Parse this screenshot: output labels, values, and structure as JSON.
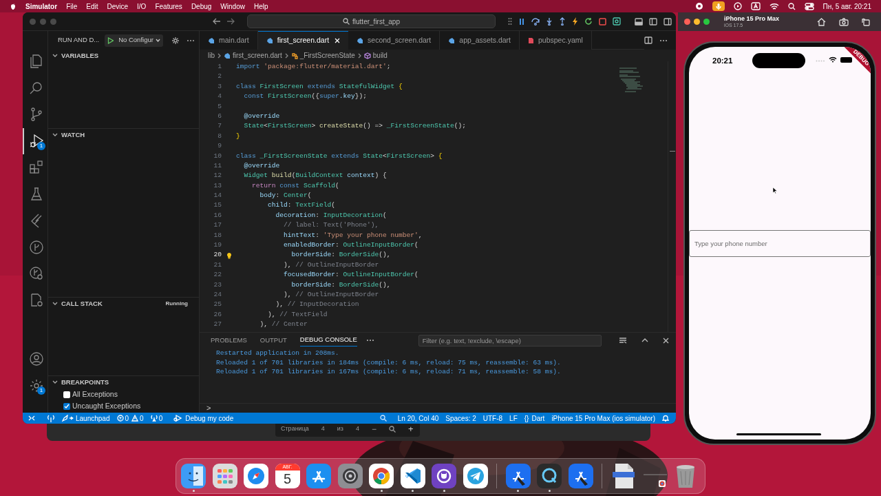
{
  "menu_bar": {
    "app": "Simulator",
    "items": [
      "File",
      "Edit",
      "Device",
      "I/O",
      "Features",
      "Debug",
      "Window",
      "Help"
    ],
    "clock": "Пн, 5 авг. 20:21"
  },
  "vscode": {
    "search": "flutter_first_app",
    "activity": [
      {
        "kind": "files",
        "selected": false
      },
      {
        "kind": "search",
        "selected": false
      },
      {
        "kind": "branch",
        "selected": false
      },
      {
        "kind": "debug",
        "selected": true,
        "badge": "1"
      },
      {
        "kind": "blocks",
        "selected": false
      },
      {
        "kind": "flask",
        "selected": false
      },
      {
        "kind": "chevrons",
        "selected": false
      },
      {
        "kind": "circle-branch",
        "selected": false
      },
      {
        "kind": "circle-branch-gear",
        "selected": false
      },
      {
        "kind": "doc-gear",
        "selected": false
      }
    ],
    "activity_bottom": [
      {
        "kind": "account"
      },
      {
        "kind": "gear",
        "badge": "1"
      }
    ],
    "sidebar": {
      "title": "RUN AND D...",
      "config": "No Configur",
      "sections": [
        {
          "title": "VARIABLES"
        },
        {
          "title": "WATCH"
        },
        {
          "title": "CALL STACK",
          "status": "Running"
        }
      ],
      "breakpoints_title": "BREAKPOINTS",
      "breakpoints": [
        {
          "label": "All Exceptions",
          "checked": false
        },
        {
          "label": "Uncaught Exceptions",
          "checked": true
        }
      ]
    },
    "tabs": [
      {
        "label": "main.dart",
        "kind": "dart",
        "selected": false
      },
      {
        "label": "first_screen.dart",
        "kind": "dart",
        "selected": true
      },
      {
        "label": "second_screen.dart",
        "kind": "dart",
        "selected": false
      },
      {
        "label": "app_assets.dart",
        "kind": "dart",
        "selected": false
      },
      {
        "label": "pubspec.yaml",
        "kind": "yaml",
        "selected": false
      }
    ],
    "breadcrumb": [
      {
        "label": "lib",
        "kind": "folder"
      },
      {
        "label": "first_screen.dart",
        "kind": "dart"
      },
      {
        "label": "_FirstScreenState",
        "kind": "class"
      },
      {
        "label": "build",
        "kind": "method"
      }
    ],
    "code": [
      {
        "n": "1",
        "current": false,
        "tokens": [
          {
            "text": "import ",
            "kind": "kw"
          },
          {
            "text": "'package:flutter/material.dart'",
            "kind": "str"
          },
          {
            "text": ";",
            "kind": "p"
          }
        ]
      },
      {
        "n": "2",
        "current": false
      },
      {
        "n": "3",
        "current": false,
        "tokens": [
          {
            "text": "class ",
            "kind": "kw"
          },
          {
            "text": "FirstScreen ",
            "kind": "cls"
          },
          {
            "text": "extends ",
            "kind": "kw"
          },
          {
            "text": "StatefulWidget ",
            "kind": "cls"
          },
          {
            "text": "{",
            "kind": "br"
          }
        ]
      },
      {
        "n": "4",
        "current": false,
        "tokens": [
          {
            "text": "  const ",
            "kind": "kw"
          },
          {
            "text": "FirstScreen",
            "kind": "cls"
          },
          {
            "text": "({",
            "kind": "p"
          },
          {
            "text": "super",
            "kind": "kw"
          },
          {
            "text": ".key",
            "kind": "var"
          },
          {
            "text": "});",
            "kind": "p"
          }
        ]
      },
      {
        "n": "5",
        "current": false
      },
      {
        "n": "6",
        "current": false,
        "tokens": [
          {
            "text": "  @override",
            "kind": "var"
          }
        ]
      },
      {
        "n": "7",
        "current": false,
        "tokens": [
          {
            "text": "  State",
            "kind": "cls"
          },
          {
            "text": "<",
            "kind": "p"
          },
          {
            "text": "FirstScreen",
            "kind": "cls"
          },
          {
            "text": "> ",
            "kind": "p"
          },
          {
            "text": "createState",
            "kind": "fn"
          },
          {
            "text": "() => ",
            "kind": "p"
          },
          {
            "text": "_FirstScreenState",
            "kind": "cls"
          },
          {
            "text": "();",
            "kind": "p"
          }
        ]
      },
      {
        "n": "8",
        "current": false,
        "tokens": [
          {
            "text": "}",
            "kind": "br"
          }
        ]
      },
      {
        "n": "9",
        "current": false
      },
      {
        "n": "10",
        "current": false,
        "tokens": [
          {
            "text": "class ",
            "kind": "kw"
          },
          {
            "text": "_FirstScreenState ",
            "kind": "cls"
          },
          {
            "text": "extends ",
            "kind": "kw"
          },
          {
            "text": "State",
            "kind": "cls"
          },
          {
            "text": "<",
            "kind": "p"
          },
          {
            "text": "FirstScreen",
            "kind": "cls"
          },
          {
            "text": "> ",
            "kind": "p"
          },
          {
            "text": "{",
            "kind": "br"
          }
        ]
      },
      {
        "n": "11",
        "current": false,
        "tokens": [
          {
            "text": "  @override",
            "kind": "var"
          }
        ]
      },
      {
        "n": "12",
        "current": false,
        "tokens": [
          {
            "text": "  Widget ",
            "kind": "cls"
          },
          {
            "text": "build",
            "kind": "fn"
          },
          {
            "text": "(",
            "kind": "p"
          },
          {
            "text": "BuildContext ",
            "kind": "cls"
          },
          {
            "text": "context",
            "kind": "var"
          },
          {
            "text": ") {",
            "kind": "p"
          }
        ]
      },
      {
        "n": "13",
        "current": false,
        "tokens": [
          {
            "text": "    return ",
            "kind": "ctrl"
          },
          {
            "text": "const ",
            "kind": "kw"
          },
          {
            "text": "Scaffold",
            "kind": "cls"
          },
          {
            "text": "(",
            "kind": "p"
          }
        ]
      },
      {
        "n": "14",
        "current": false,
        "tokens": [
          {
            "text": "      body",
            "kind": "var"
          },
          {
            "text": ": ",
            "kind": "p"
          },
          {
            "text": "Center",
            "kind": "cls"
          },
          {
            "text": "(",
            "kind": "p"
          }
        ]
      },
      {
        "n": "15",
        "current": false,
        "tokens": [
          {
            "text": "        child",
            "kind": "var"
          },
          {
            "text": ": ",
            "kind": "p"
          },
          {
            "text": "TextField",
            "kind": "cls"
          },
          {
            "text": "(",
            "kind": "p"
          }
        ]
      },
      {
        "n": "16",
        "current": false,
        "tokens": [
          {
            "text": "          decoration",
            "kind": "var"
          },
          {
            "text": ": ",
            "kind": "p"
          },
          {
            "text": "InputDecoration",
            "kind": "cls"
          },
          {
            "text": "(",
            "kind": "p"
          }
        ]
      },
      {
        "n": "17",
        "current": false,
        "tokens": [
          {
            "text": "            // label: Text('Phone'),",
            "kind": "com"
          }
        ]
      },
      {
        "n": "18",
        "current": false,
        "tokens": [
          {
            "text": "            hintText",
            "kind": "var"
          },
          {
            "text": ": ",
            "kind": "p"
          },
          {
            "text": "'Type your phone number'",
            "kind": "str"
          },
          {
            "text": ",",
            "kind": "p"
          }
        ]
      },
      {
        "n": "19",
        "current": false,
        "tokens": [
          {
            "text": "            enabledBorder",
            "kind": "var"
          },
          {
            "text": ": ",
            "kind": "p"
          },
          {
            "text": "OutlineInputBorder",
            "kind": "cls"
          },
          {
            "text": "(",
            "kind": "p"
          }
        ]
      },
      {
        "n": "20",
        "current": true,
        "tokens": [
          {
            "text": "              borderSide",
            "kind": "var"
          },
          {
            "text": ": ",
            "kind": "p"
          },
          {
            "text": "BorderSide",
            "kind": "cls"
          },
          {
            "text": "(),",
            "kind": "p"
          }
        ]
      },
      {
        "n": "21",
        "current": false,
        "tokens": [
          {
            "text": "            ), ",
            "kind": "p"
          },
          {
            "text": "// OutlineInputBorder",
            "kind": "com"
          }
        ]
      },
      {
        "n": "22",
        "current": false,
        "tokens": [
          {
            "text": "            focusedBorder",
            "kind": "var"
          },
          {
            "text": ": ",
            "kind": "p"
          },
          {
            "text": "OutlineInputBorder",
            "kind": "cls"
          },
          {
            "text": "(",
            "kind": "p"
          }
        ]
      },
      {
        "n": "23",
        "current": false,
        "tokens": [
          {
            "text": "              borderSide",
            "kind": "var"
          },
          {
            "text": ": ",
            "kind": "p"
          },
          {
            "text": "BorderSide",
            "kind": "cls"
          },
          {
            "text": "(),",
            "kind": "p"
          }
        ]
      },
      {
        "n": "24",
        "current": false,
        "tokens": [
          {
            "text": "            ), ",
            "kind": "p"
          },
          {
            "text": "// OutlineInputBorder",
            "kind": "com"
          }
        ]
      },
      {
        "n": "25",
        "current": false,
        "tokens": [
          {
            "text": "          ), ",
            "kind": "p"
          },
          {
            "text": "// InputDecoration",
            "kind": "com"
          }
        ]
      },
      {
        "n": "26",
        "current": false,
        "tokens": [
          {
            "text": "        ), ",
            "kind": "p"
          },
          {
            "text": "// TextField",
            "kind": "com"
          }
        ]
      },
      {
        "n": "27",
        "current": false,
        "tokens": [
          {
            "text": "      ), ",
            "kind": "p"
          },
          {
            "text": "// Center",
            "kind": "com"
          }
        ]
      }
    ],
    "panel": {
      "tabs": [
        {
          "label": "PROBLEMS",
          "selected": false
        },
        {
          "label": "OUTPUT",
          "selected": false
        },
        {
          "label": "DEBUG CONSOLE",
          "selected": true
        }
      ],
      "filter_placeholder": "Filter (e.g. text, !exclude, \\escape)",
      "lines": [
        "Restarted application in 208ms.",
        "Reloaded 1 of 701 libraries in 184ms (compile: 6 ms, reload: 75 ms, reassemble: 63 ms).",
        "Reloaded 1 of 701 libraries in 167ms (compile: 6 ms, reload: 71 ms, reassemble: 58 ms)."
      ],
      "prompt": ">"
    },
    "status_bar": {
      "launchpad": "Launchpad",
      "errors": "0",
      "warnings": "0",
      "ports": "0",
      "debug": "Debug my code",
      "items": [
        "Ln 20, Col 40",
        "Spaces: 2",
        "UTF-8",
        "LF"
      ],
      "language_icon": "{}",
      "language": "Dart",
      "device": "iPhone 15 Pro Max (ios simulator)"
    }
  },
  "pdf_toolbar": {
    "label": "Страница",
    "page": "4",
    "of": "из",
    "total": "4",
    "minus": "−",
    "plus": "+"
  },
  "simulator": {
    "title": "iPhone 15 Pro Max",
    "os": "iOS 17.5",
    "time": "20:21",
    "banner": "DEBUG",
    "placeholder": "Type your phone number"
  },
  "dock": [
    {
      "kind": "finder",
      "running": true
    },
    {
      "kind": "launchpad",
      "running": false
    },
    {
      "kind": "safari",
      "running": false
    },
    {
      "kind": "calendar",
      "running": false,
      "month": "АВГ.",
      "day": "5"
    },
    {
      "kind": "appstore",
      "running": false
    },
    {
      "kind": "settings",
      "running": false
    },
    {
      "kind": "chrome",
      "running": true
    },
    {
      "kind": "vscode",
      "running": true
    },
    {
      "kind": "github",
      "running": true
    },
    {
      "kind": "telegram",
      "running": false
    },
    {
      "kind": "separator"
    },
    {
      "kind": "xcode",
      "running": true
    },
    {
      "kind": "quicktime",
      "running": true
    },
    {
      "kind": "xcode",
      "running": false
    },
    {
      "kind": "separator"
    },
    {
      "kind": "document",
      "running": false
    },
    {
      "kind": "stack",
      "running": false
    },
    {
      "kind": "trash",
      "running": false
    }
  ]
}
